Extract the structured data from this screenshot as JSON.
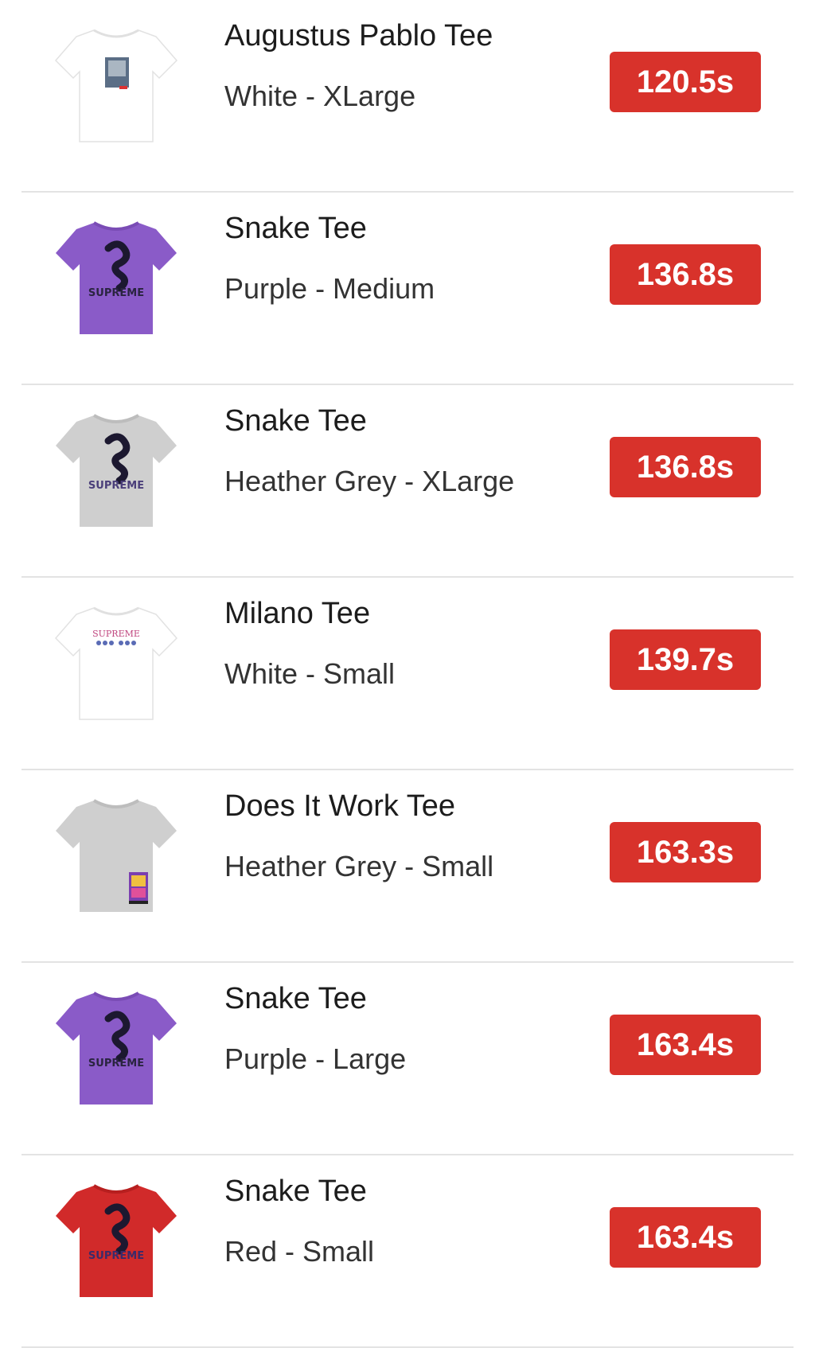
{
  "items": [
    {
      "name": "Augustus Pablo Tee",
      "variant": "White - XLarge",
      "time": "120.5s",
      "color": "#ffffff",
      "graphic": "photo"
    },
    {
      "name": "Snake Tee",
      "variant": "Purple - Medium",
      "time": "136.8s",
      "color": "#8a5bc8",
      "graphic": "snake"
    },
    {
      "name": "Snake Tee",
      "variant": "Heather Grey - XLarge",
      "time": "136.8s",
      "color": "#cfcfcf",
      "graphic": "snake"
    },
    {
      "name": "Milano Tee",
      "variant": "White - Small",
      "time": "139.7s",
      "color": "#ffffff",
      "graphic": "milano"
    },
    {
      "name": "Does It Work Tee",
      "variant": "Heather Grey - Small",
      "time": "163.3s",
      "color": "#cfcfcf",
      "graphic": "poster"
    },
    {
      "name": "Snake Tee",
      "variant": "Purple - Large",
      "time": "163.4s",
      "color": "#8a5bc8",
      "graphic": "snake"
    },
    {
      "name": "Snake Tee",
      "variant": "Red - Small",
      "time": "163.4s",
      "color": "#d12a2a",
      "graphic": "snake"
    }
  ],
  "milano_print": "SUPREME",
  "badge_color": "#d8322b"
}
